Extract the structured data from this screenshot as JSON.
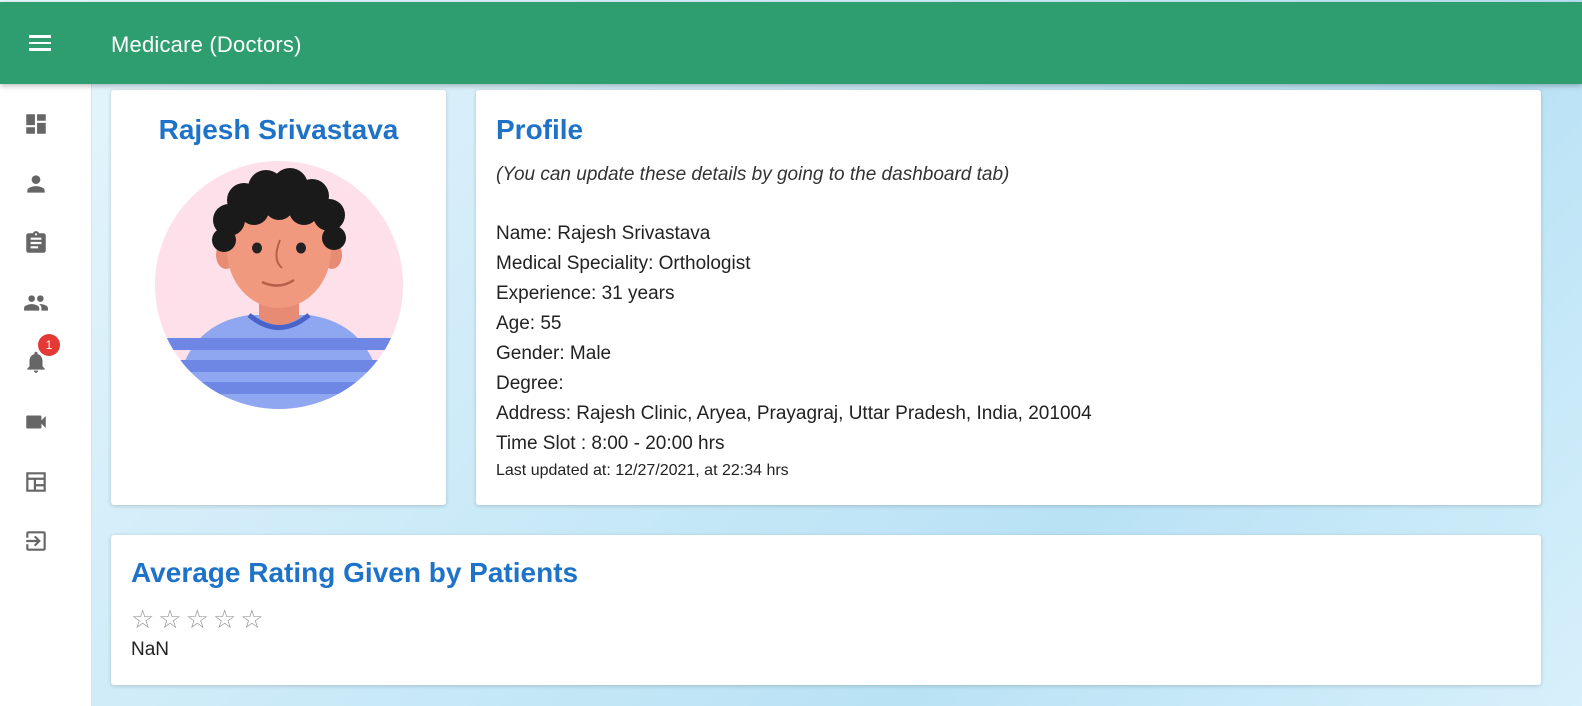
{
  "appbar": {
    "title": "Medicare (Doctors)",
    "color": "#2f9e6f",
    "menu_icon": "menu-icon"
  },
  "sidebar": {
    "items": [
      {
        "icon": "dashboard-icon"
      },
      {
        "icon": "person-icon"
      },
      {
        "icon": "clipboard-icon"
      },
      {
        "icon": "people-icon"
      },
      {
        "icon": "bell-icon",
        "badge": "1"
      },
      {
        "icon": "videocam-icon"
      },
      {
        "icon": "calendar-view-icon"
      },
      {
        "icon": "logout-icon"
      }
    ]
  },
  "doctor_card": {
    "name": "Rajesh Srivastava",
    "avatar_icon": "doctor-avatar"
  },
  "profile": {
    "heading": "Profile",
    "note": "(You can update these details by going to the dashboard tab)",
    "name": "Name: Rajesh Srivastava",
    "speciality": "Medical Speciality: Orthologist",
    "experience": "Experience: 31 years",
    "age": "Age: 55",
    "gender": "Gender: Male",
    "degree": "Degree:",
    "address": "Address: Rajesh Clinic, Aryea, Prayagraj, Uttar Pradesh, India, 201004",
    "time_slot": "Time Slot : 8:00 - 20:00 hrs",
    "last_updated": "Last updated at: 12/27/2021, at 22:34 hrs"
  },
  "rating": {
    "heading": "Average Rating Given by Patients",
    "stars_filled": 0,
    "stars_total": 5,
    "value": "NaN"
  },
  "colors": {
    "heading_blue": "#1e73c8",
    "badge_red": "#e53935"
  }
}
